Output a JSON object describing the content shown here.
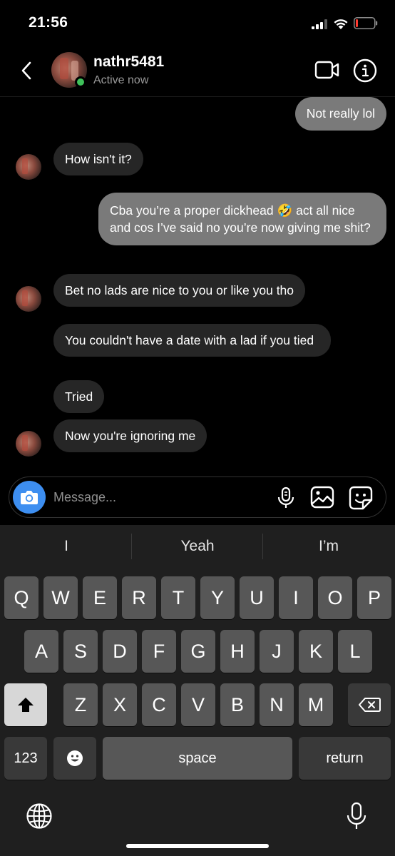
{
  "status_bar": {
    "time": "21:56"
  },
  "header": {
    "username": "nathr5481",
    "status": "Active now"
  },
  "messages": [
    {
      "side": "sent",
      "text": "Not really lol"
    },
    {
      "side": "recv",
      "text": "How isn't it?"
    },
    {
      "side": "sent",
      "text": "Cba you’re a proper dickhead 🤣 act all nice and cos I’ve said no you’re now giving me shit?"
    },
    {
      "side": "recv",
      "text": "Bet no lads are nice to you or like you tho"
    },
    {
      "side": "recv",
      "text": "You couldn't have a date with a lad if you tied"
    },
    {
      "side": "recv",
      "text": "Tried"
    },
    {
      "side": "recv",
      "text": "Now you're ignoring me"
    }
  ],
  "composer": {
    "placeholder": "Message..."
  },
  "keyboard": {
    "suggestions": [
      "I",
      "Yeah",
      "I’m"
    ],
    "row1": [
      "Q",
      "W",
      "E",
      "R",
      "T",
      "Y",
      "U",
      "I",
      "O",
      "P"
    ],
    "row2": [
      "A",
      "S",
      "D",
      "F",
      "G",
      "H",
      "J",
      "K",
      "L"
    ],
    "row3": [
      "Z",
      "X",
      "C",
      "V",
      "B",
      "N",
      "M"
    ],
    "numbers_label": "123",
    "space_label": "space",
    "return_label": "return"
  },
  "colors": {
    "sent_bubble": "#7a7a7a",
    "received_bubble": "#262626",
    "online": "#3fc15a",
    "camera_button": "#3d8ef0"
  }
}
